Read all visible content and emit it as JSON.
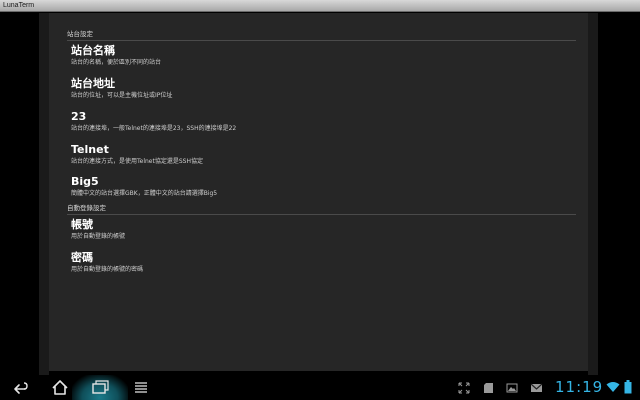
{
  "app": {
    "title": "LunaTerm"
  },
  "sections": [
    {
      "header": "站台設定"
    },
    {
      "header": "自動登錄設定"
    }
  ],
  "prefs": [
    {
      "title": "站台名稱",
      "summary": "站台的名稱，便於區別不同的站台"
    },
    {
      "title": "站台地址",
      "summary": "站台的位址，可以是主機位址或IP位址"
    },
    {
      "title": "23",
      "summary": "站台的連接埠，一般Telnet的連接埠是23，SSH的連接埠是22"
    },
    {
      "title": "Telnet",
      "summary": "站台的連接方式，是使用Telnet協定還是SSH協定"
    },
    {
      "title": "Big5",
      "summary": "簡體中文的站台選擇GBK，正體中文的站台請選擇Big5"
    },
    {
      "title": "帳號",
      "summary": "用於自動登錄的帳號"
    },
    {
      "title": "密碼",
      "summary": "用於自動登錄的帳號的密碼"
    }
  ],
  "status_bar": {
    "time": "11:19",
    "accent_color": "#35b5e5",
    "icons": [
      "fullscreen-icon",
      "sd-card-icon",
      "gallery-icon",
      "gmail-icon",
      "wifi-icon",
      "battery-icon"
    ]
  },
  "nav_bar": {
    "buttons": [
      "back-icon",
      "home-icon",
      "recent-apps-icon",
      "menu-icon"
    ]
  }
}
